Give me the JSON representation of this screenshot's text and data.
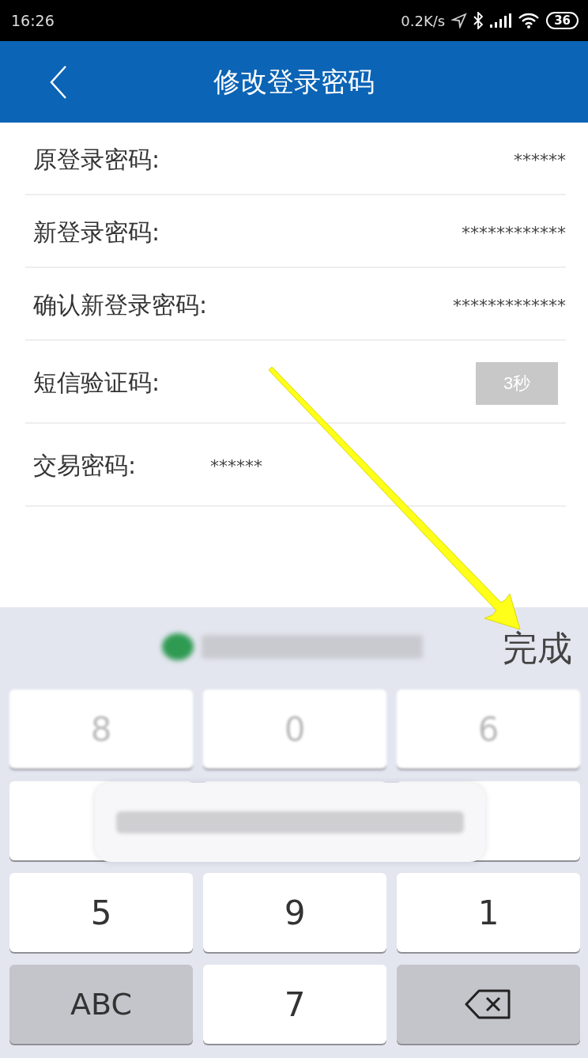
{
  "status_bar": {
    "time": "16:26",
    "speed": "0.2K/s",
    "battery": "36"
  },
  "header": {
    "title": "修改登录密码"
  },
  "fields": [
    {
      "kind": "password",
      "label": "原登录密码:",
      "value": "******"
    },
    {
      "kind": "password",
      "label": "新登录密码:",
      "value": "************"
    },
    {
      "kind": "password",
      "label": "确认新登录密码:",
      "value": "*************"
    },
    {
      "kind": "code",
      "label": "短信验证码:",
      "button": "3秒",
      "disabled": true
    },
    {
      "kind": "inline",
      "label": "交易密码:",
      "value": "******"
    }
  ],
  "keyboard": {
    "done": "完成",
    "rows": [
      [
        {
          "kind": "blurred",
          "label": "8"
        },
        {
          "kind": "blurred",
          "label": "0"
        },
        {
          "kind": "blurred",
          "label": "6"
        }
      ],
      [
        {
          "kind": "covered"
        },
        {
          "kind": "covered"
        },
        {
          "kind": "covered"
        }
      ],
      [
        {
          "kind": "digit",
          "label": "5"
        },
        {
          "kind": "digit",
          "label": "9"
        },
        {
          "kind": "digit",
          "label": "1"
        }
      ],
      [
        {
          "kind": "function",
          "label": "ABC"
        },
        {
          "kind": "digit",
          "label": "7"
        },
        {
          "kind": "backspace"
        }
      ]
    ]
  }
}
